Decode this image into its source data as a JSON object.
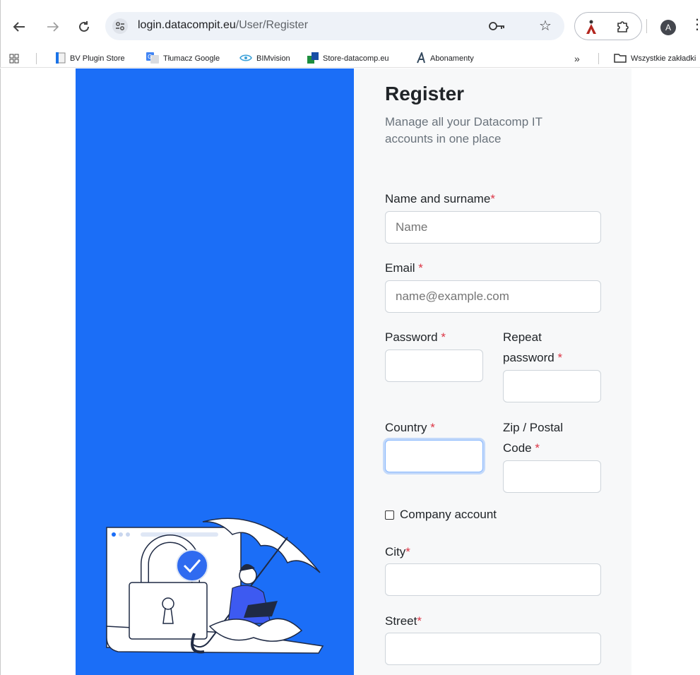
{
  "browser": {
    "url_host": "login.datacompit.eu",
    "url_path": "/User/Register",
    "avatar_letter": "A",
    "bookmarks": [
      {
        "label": "BV Plugin Store"
      },
      {
        "label": "Tłumacz Google"
      },
      {
        "label": "BIMvision"
      },
      {
        "label": "Store-datacomp.eu"
      },
      {
        "label": "Abonamenty"
      }
    ],
    "more_label": "»",
    "all_bookmarks_label": "Wszystkie zakładki"
  },
  "form": {
    "title": "Register",
    "subtitle": "Manage all your Datacomp IT accounts in one place",
    "required_mark": "*",
    "name_label": "Name and surname",
    "name_placeholder": "Name",
    "email_label": "Email",
    "email_placeholder": "name@example.com",
    "password_label": "Password",
    "repeat_password_label_1": "Repeat",
    "repeat_password_label_2": "password",
    "country_label": "Country",
    "zip_label_1": "Zip / Postal",
    "zip_label_2": "Code",
    "company_label": "Company account",
    "city_label": "City",
    "street_label": "Street"
  },
  "colors": {
    "hero_blue": "#1b6ef7",
    "required_red": "#dc3545",
    "focus_blue": "#86b7fe"
  }
}
